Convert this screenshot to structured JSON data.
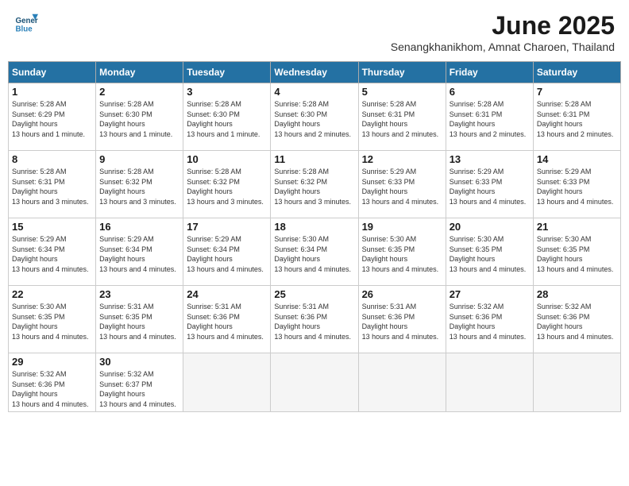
{
  "header": {
    "logo_line1": "General",
    "logo_line2": "Blue",
    "month": "June 2025",
    "location": "Senangkhanikhom, Amnat Charoen, Thailand"
  },
  "weekdays": [
    "Sunday",
    "Monday",
    "Tuesday",
    "Wednesday",
    "Thursday",
    "Friday",
    "Saturday"
  ],
  "weeks": [
    [
      {
        "day": "1",
        "sunrise": "5:28 AM",
        "sunset": "6:29 PM",
        "daylight": "13 hours and 1 minute."
      },
      {
        "day": "2",
        "sunrise": "5:28 AM",
        "sunset": "6:30 PM",
        "daylight": "13 hours and 1 minute."
      },
      {
        "day": "3",
        "sunrise": "5:28 AM",
        "sunset": "6:30 PM",
        "daylight": "13 hours and 1 minute."
      },
      {
        "day": "4",
        "sunrise": "5:28 AM",
        "sunset": "6:30 PM",
        "daylight": "13 hours and 2 minutes."
      },
      {
        "day": "5",
        "sunrise": "5:28 AM",
        "sunset": "6:31 PM",
        "daylight": "13 hours and 2 minutes."
      },
      {
        "day": "6",
        "sunrise": "5:28 AM",
        "sunset": "6:31 PM",
        "daylight": "13 hours and 2 minutes."
      },
      {
        "day": "7",
        "sunrise": "5:28 AM",
        "sunset": "6:31 PM",
        "daylight": "13 hours and 2 minutes."
      }
    ],
    [
      {
        "day": "8",
        "sunrise": "5:28 AM",
        "sunset": "6:31 PM",
        "daylight": "13 hours and 3 minutes."
      },
      {
        "day": "9",
        "sunrise": "5:28 AM",
        "sunset": "6:32 PM",
        "daylight": "13 hours and 3 minutes."
      },
      {
        "day": "10",
        "sunrise": "5:28 AM",
        "sunset": "6:32 PM",
        "daylight": "13 hours and 3 minutes."
      },
      {
        "day": "11",
        "sunrise": "5:28 AM",
        "sunset": "6:32 PM",
        "daylight": "13 hours and 3 minutes."
      },
      {
        "day": "12",
        "sunrise": "5:29 AM",
        "sunset": "6:33 PM",
        "daylight": "13 hours and 4 minutes."
      },
      {
        "day": "13",
        "sunrise": "5:29 AM",
        "sunset": "6:33 PM",
        "daylight": "13 hours and 4 minutes."
      },
      {
        "day": "14",
        "sunrise": "5:29 AM",
        "sunset": "6:33 PM",
        "daylight": "13 hours and 4 minutes."
      }
    ],
    [
      {
        "day": "15",
        "sunrise": "5:29 AM",
        "sunset": "6:34 PM",
        "daylight": "13 hours and 4 minutes."
      },
      {
        "day": "16",
        "sunrise": "5:29 AM",
        "sunset": "6:34 PM",
        "daylight": "13 hours and 4 minutes."
      },
      {
        "day": "17",
        "sunrise": "5:29 AM",
        "sunset": "6:34 PM",
        "daylight": "13 hours and 4 minutes."
      },
      {
        "day": "18",
        "sunrise": "5:30 AM",
        "sunset": "6:34 PM",
        "daylight": "13 hours and 4 minutes."
      },
      {
        "day": "19",
        "sunrise": "5:30 AM",
        "sunset": "6:35 PM",
        "daylight": "13 hours and 4 minutes."
      },
      {
        "day": "20",
        "sunrise": "5:30 AM",
        "sunset": "6:35 PM",
        "daylight": "13 hours and 4 minutes."
      },
      {
        "day": "21",
        "sunrise": "5:30 AM",
        "sunset": "6:35 PM",
        "daylight": "13 hours and 4 minutes."
      }
    ],
    [
      {
        "day": "22",
        "sunrise": "5:30 AM",
        "sunset": "6:35 PM",
        "daylight": "13 hours and 4 minutes."
      },
      {
        "day": "23",
        "sunrise": "5:31 AM",
        "sunset": "6:35 PM",
        "daylight": "13 hours and 4 minutes."
      },
      {
        "day": "24",
        "sunrise": "5:31 AM",
        "sunset": "6:36 PM",
        "daylight": "13 hours and 4 minutes."
      },
      {
        "day": "25",
        "sunrise": "5:31 AM",
        "sunset": "6:36 PM",
        "daylight": "13 hours and 4 minutes."
      },
      {
        "day": "26",
        "sunrise": "5:31 AM",
        "sunset": "6:36 PM",
        "daylight": "13 hours and 4 minutes."
      },
      {
        "day": "27",
        "sunrise": "5:32 AM",
        "sunset": "6:36 PM",
        "daylight": "13 hours and 4 minutes."
      },
      {
        "day": "28",
        "sunrise": "5:32 AM",
        "sunset": "6:36 PM",
        "daylight": "13 hours and 4 minutes."
      }
    ],
    [
      {
        "day": "29",
        "sunrise": "5:32 AM",
        "sunset": "6:36 PM",
        "daylight": "13 hours and 4 minutes."
      },
      {
        "day": "30",
        "sunrise": "5:32 AM",
        "sunset": "6:37 PM",
        "daylight": "13 hours and 4 minutes."
      },
      null,
      null,
      null,
      null,
      null
    ]
  ]
}
